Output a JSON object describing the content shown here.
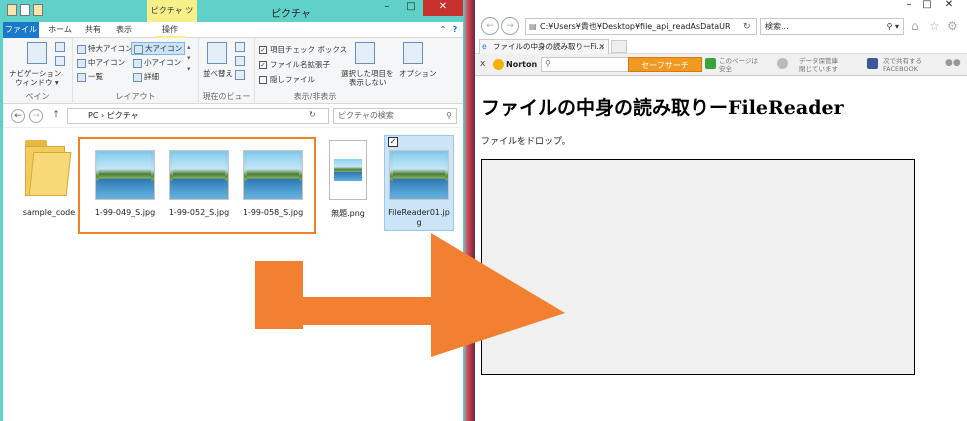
{
  "explorer": {
    "title": "ピクチャ",
    "context_tab": "ピクチャ ツール",
    "tabs": [
      "ファイル",
      "ホーム",
      "共有",
      "表示",
      "操作"
    ],
    "ribbon": {
      "pane_group": {
        "label": "ペイン",
        "nav_pane": "ナビゲーション",
        "nav_pane2": "ウィンドウ ▾"
      },
      "layout_group": {
        "label": "レイアウト",
        "items": [
          "特大アイコン",
          "大アイコン",
          "中アイコン",
          "小アイコン",
          "一覧",
          "詳細"
        ]
      },
      "view_group": {
        "label": "現在のビュー",
        "sort": "並べ替え"
      },
      "showhide_group": {
        "label": "表示/非表示",
        "item_checkboxes": "項目チェック ボックス",
        "file_ext": "ファイル名拡張子",
        "hidden_files": "隠しファイル",
        "hide_selected": "選択した項目を",
        "hide_selected2": "表示しない",
        "options": "オプション"
      }
    },
    "address": {
      "path": "PC  ›  ピクチャ",
      "search_placeholder": "ピクチャの検索"
    },
    "files": [
      {
        "name": "sample_code",
        "type": "folder"
      },
      {
        "name": "1-99-049_S.jpg",
        "type": "image"
      },
      {
        "name": "1-99-052_S.jpg",
        "type": "image"
      },
      {
        "name": "1-99-058_S.jpg",
        "type": "image"
      },
      {
        "name": "無題.png",
        "type": "image"
      },
      {
        "name": "FileReader01.jpg",
        "type": "image"
      }
    ],
    "selected_file_name_line1": "FileReader01.jp",
    "selected_file_name_line2": "g"
  },
  "ie": {
    "url": "C:¥Users¥貴也¥Desktop¥file_api_readAsDataUR",
    "search_placeholder": "検索...",
    "tab_title": "ファイルの中身の読み取りーFi...",
    "norton": {
      "close": "x",
      "logo": "Norton",
      "safe_search": "セーフサーチ",
      "page_safe_1": "このページは",
      "page_safe_2": "安全",
      "data_safe_1": "データ保管庫",
      "data_safe_2": "閉じています",
      "share_1": "次で共有する",
      "share_2": "FACEBOOK"
    },
    "page": {
      "heading": "ファイルの中身の読み取りーFileReader",
      "instruction": "ファイルをドロップ。"
    }
  },
  "colors": {
    "accent_orange": "#f08224",
    "explorer_chrome": "#5fd1c8",
    "file_tab_blue": "#1979ca",
    "norton_button": "#f19a22",
    "dropzone_bg": "#f0f0f0"
  }
}
